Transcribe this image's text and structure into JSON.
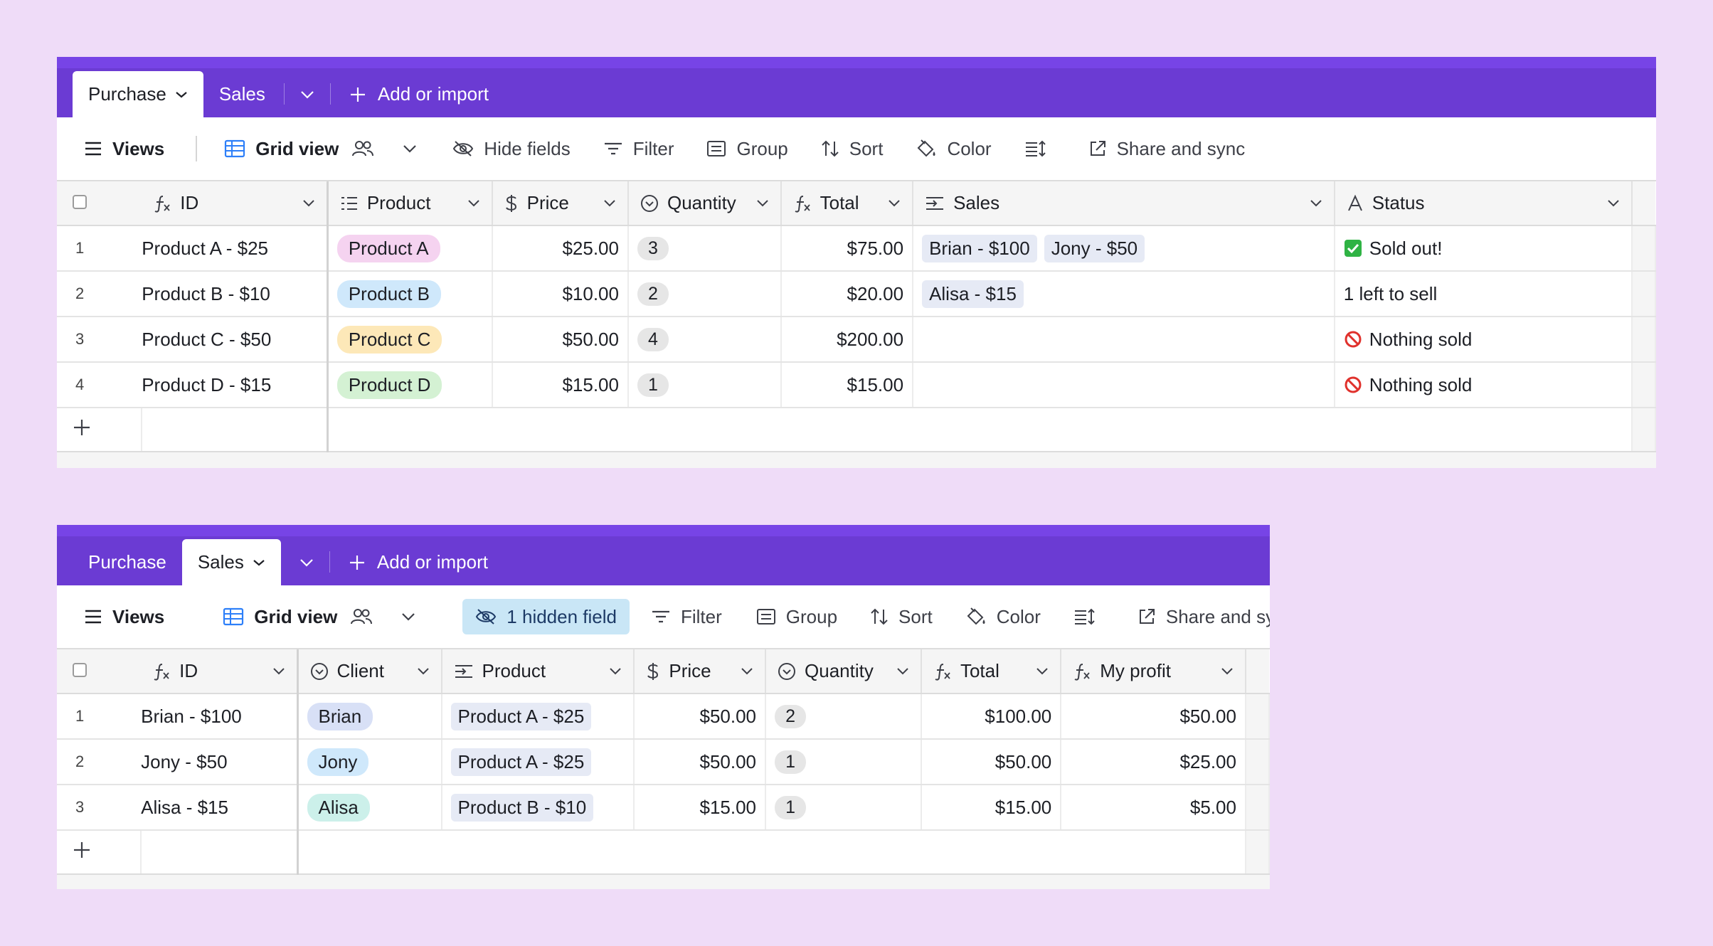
{
  "colors": {
    "background": "#efdcf8",
    "tabbar": "#6b3bd3",
    "tabbar_top": "#7744e6",
    "hidden_field_bg": "#c9e6f6"
  },
  "purchase_panel": {
    "tabs": [
      {
        "label": "Purchase",
        "active": true
      },
      {
        "label": "Sales",
        "active": false
      }
    ],
    "add_import": "Add or import",
    "toolbar": {
      "views": "Views",
      "grid_view": "Grid view",
      "hide_fields": "Hide fields",
      "filter": "Filter",
      "group": "Group",
      "sort": "Sort",
      "color": "Color",
      "share": "Share and sync"
    },
    "columns": {
      "id": "ID",
      "product": "Product",
      "price": "Price",
      "quantity": "Quantity",
      "total": "Total",
      "sales": "Sales",
      "status": "Status"
    },
    "rows": [
      {
        "n": "1",
        "id": "Product A - $25",
        "product": "Product A",
        "price": "$25.00",
        "qty": "3",
        "total": "$75.00",
        "sales": [
          "Brian - $100",
          "Jony - $50"
        ],
        "status": "Sold out!",
        "status_icon": "check-mark-icon"
      },
      {
        "n": "2",
        "id": "Product B - $10",
        "product": "Product B",
        "price": "$10.00",
        "qty": "2",
        "total": "$20.00",
        "sales": [
          "Alisa - $15"
        ],
        "status": "1 left to sell",
        "status_icon": ""
      },
      {
        "n": "3",
        "id": "Product C - $50",
        "product": "Product C",
        "price": "$50.00",
        "qty": "4",
        "total": "$200.00",
        "sales": [],
        "status": "Nothing sold",
        "status_icon": "prohibited-icon"
      },
      {
        "n": "4",
        "id": "Product D - $15",
        "product": "Product D",
        "price": "$15.00",
        "qty": "1",
        "total": "$15.00",
        "sales": [],
        "status": "Nothing sold",
        "status_icon": "prohibited-icon"
      }
    ],
    "product_colors": {
      "Product A": "#f5d3f0",
      "Product B": "#cfe8fb",
      "Product C": "#fde8b8",
      "Product D": "#d4f1d3"
    }
  },
  "sales_panel": {
    "tabs": [
      {
        "label": "Purchase",
        "active": false
      },
      {
        "label": "Sales",
        "active": true
      }
    ],
    "add_import": "Add or import",
    "toolbar": {
      "views": "Views",
      "grid_view": "Grid view",
      "hidden_field": "1 hidden field",
      "filter": "Filter",
      "group": "Group",
      "sort": "Sort",
      "color": "Color",
      "share": "Share and sync"
    },
    "columns": {
      "id": "ID",
      "client": "Client",
      "product": "Product",
      "price": "Price",
      "quantity": "Quantity",
      "total": "Total",
      "profit": "My profit"
    },
    "rows": [
      {
        "n": "1",
        "id": "Brian - $100",
        "client": "Brian",
        "product": "Product A - $25",
        "price": "$50.00",
        "qty": "2",
        "total": "$100.00",
        "profit": "$50.00"
      },
      {
        "n": "2",
        "id": "Jony - $50",
        "client": "Jony",
        "product": "Product A - $25",
        "price": "$50.00",
        "qty": "1",
        "total": "$50.00",
        "profit": "$25.00"
      },
      {
        "n": "3",
        "id": "Alisa - $15",
        "client": "Alisa",
        "product": "Product B - $10",
        "price": "$15.00",
        "qty": "1",
        "total": "$15.00",
        "profit": "$5.00"
      }
    ],
    "client_colors": {
      "Brian": "#d8e0f6",
      "Jony": "#cfe8fb",
      "Alisa": "#ccf0ea"
    }
  }
}
